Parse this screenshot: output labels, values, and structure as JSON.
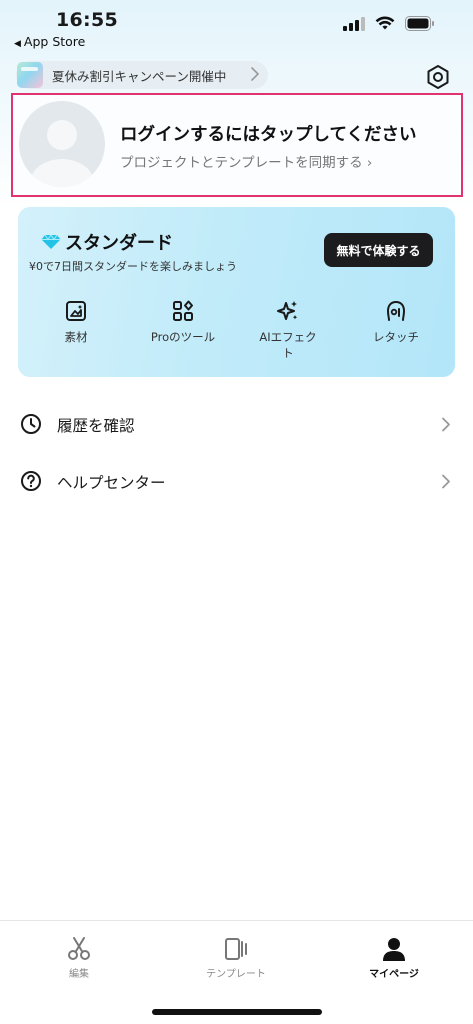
{
  "status_bar": {
    "time": "16:55",
    "back_label": "App Store"
  },
  "promo_banner": {
    "text": "夏休み割引キャンペーン開催中"
  },
  "login_card": {
    "title": "ログインするにはタップしてください",
    "subtitle": "プロジェクトとテンプレートを同期する ›",
    "highlight_color": "#e0336f"
  },
  "standard_card": {
    "title": "スタンダード",
    "subtitle": "¥0で7日間スタンダードを楽しみましょう",
    "trial_button": "無料で体験する",
    "features": [
      {
        "label": "素材",
        "icon": "material-image-icon"
      },
      {
        "label": "Proのツール",
        "icon": "pro-tools-grid-icon"
      },
      {
        "label": "AIエフェク\nト",
        "icon": "ai-effect-sparkle-icon"
      },
      {
        "label": "レタッチ",
        "icon": "retouch-face-icon"
      }
    ],
    "accent_color": "#b3e6f9"
  },
  "menu": [
    {
      "label": "履歴を確認",
      "icon": "history-clock-icon"
    },
    {
      "label": "ヘルプセンター",
      "icon": "help-question-icon"
    }
  ],
  "tabbar": {
    "tabs": [
      {
        "label": "編集",
        "icon": "scissors-icon",
        "active": false
      },
      {
        "label": "テンプレート",
        "icon": "template-icon",
        "active": false
      },
      {
        "label": "マイページ",
        "icon": "person-icon",
        "active": true
      }
    ]
  }
}
